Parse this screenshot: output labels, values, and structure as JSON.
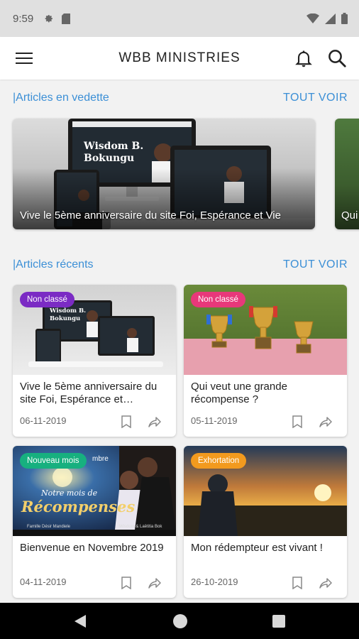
{
  "status": {
    "time": "9:59"
  },
  "app": {
    "title": "WBB MINISTRIES"
  },
  "featured": {
    "heading": "|Articles en vedette",
    "see_all": "TOUT VOIR",
    "items": [
      {
        "title": "Vive le 5ème anniversaire du site Foi, Espérance et Vie",
        "screen_name": "Wisdom B. Bokungu"
      },
      {
        "title": "Qui"
      }
    ]
  },
  "recent": {
    "heading": "|Articles récents",
    "see_all": "TOUT VOIR",
    "items": [
      {
        "badge": "Non classé",
        "badge_color": "#7b2bc4",
        "title": "Vive le 5ème anniversaire du site Foi, Espérance et…",
        "date": "06-11-2019",
        "screen_name": "Wisdom B. Bokungu"
      },
      {
        "badge": "Non classé",
        "badge_color": "#e8387a",
        "title": "Qui veut une grande récompense ?",
        "date": "05-11-2019"
      },
      {
        "badge": "Nouveau mois",
        "badge_color": "#17b07f",
        "title": "Bienvenue en Novembre 2019",
        "date": "04-11-2019",
        "poster_line1": "Notre mois de",
        "poster_line2": "Récompenses",
        "poster_tag": "mbre",
        "poster_footer_left": "Famille Désir Mandiele",
        "poster_footer_right": "Wisdom & Laëtitia Bok"
      },
      {
        "badge": "Exhortation",
        "badge_color": "#f29a1e",
        "title": "Mon rédempteur est vivant !",
        "date": "26-10-2019"
      }
    ]
  },
  "colors": {
    "accent": "#3b8fd6"
  }
}
